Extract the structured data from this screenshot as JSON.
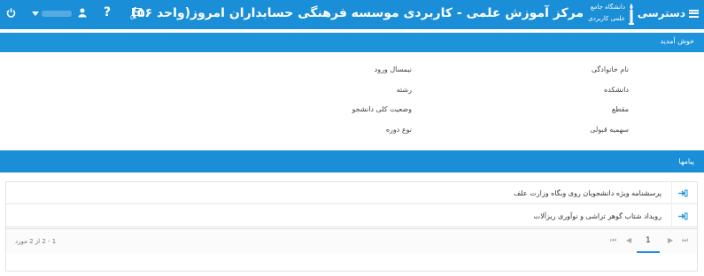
{
  "header": {
    "menu_label": "دسترسی",
    "logo_line1": "دانشگاه جامع",
    "logo_line2": "علمی کاربردی",
    "title": "مرکز آموزش علمی - کاربردی موسسه فرهنگی حسابداران امروز(واحد ۵۶)",
    "help_label": "?",
    "mail_count": "0",
    "icons": [
      "menu-icon",
      "torch-logo",
      "mail-icon",
      "help-icon",
      "user-icon",
      "caret-down-icon",
      "power-icon"
    ]
  },
  "welcome": {
    "text": "خوش آمدید"
  },
  "profile": {
    "labels_right": [
      "نام خانوادگی",
      "دانشکده",
      "مقطع",
      "سهمیه قبولی"
    ],
    "labels_left": [
      "نیمسال ورود",
      "رشته",
      "وضعیت کلی دانشجو",
      "نوع دوره"
    ]
  },
  "messages": {
    "title": "پیامها",
    "items": [
      "پرسشنامه ویژه دانشجویان روی وبگاه وزارت علف",
      "رویداد شتاب گوهر تراشی و نوآوری ریزآلات"
    ],
    "pager": {
      "info": "1 - 2 از 2 مورد",
      "current_page": "1",
      "first": "⏮",
      "prev": "◀",
      "next": "▶",
      "last": "⏭"
    }
  },
  "colors": {
    "primary": "#1a8fd8",
    "text": "#333333"
  }
}
